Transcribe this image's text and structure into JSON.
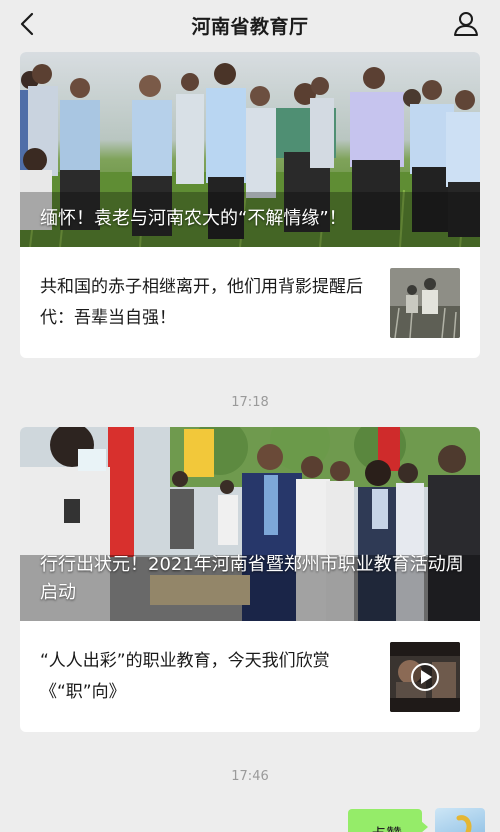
{
  "header": {
    "title": "河南省教育厅",
    "back_icon": "chevron-left-icon",
    "profile_icon": "person-icon"
  },
  "articles": [
    {
      "headline": "缅怀！袁老与河南农大的“不解情缘”！",
      "sub_item": "共和国的赤子相继离开，他们用背影提醒后代：吾辈当自强！"
    },
    {
      "headline": "行行出状元！2021年河南省暨郑州市职业教育活动周启动",
      "sub_item": "“人人出彩”的职业教育，今天我们欣赏《“职”向》"
    }
  ],
  "timestamps": [
    "17:18",
    "17:46"
  ],
  "chat": {
    "bubble_text": "点赞"
  },
  "colors": {
    "background": "#ededed",
    "card": "#ffffff",
    "bubble": "#95ec69"
  }
}
